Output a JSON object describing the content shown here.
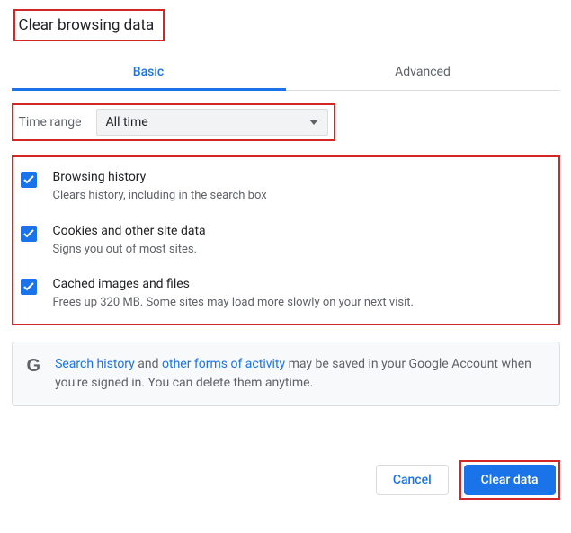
{
  "title": "Clear browsing data",
  "tabs": {
    "basic": "Basic",
    "advanced": "Advanced"
  },
  "timerange": {
    "label": "Time range",
    "selected": "All time"
  },
  "options": [
    {
      "title": "Browsing history",
      "desc": "Clears history, including in the search box",
      "checked": true
    },
    {
      "title": "Cookies and other site data",
      "desc": "Signs you out of most sites.",
      "checked": true
    },
    {
      "title": "Cached images and files",
      "desc": "Frees up 320 MB. Some sites may load more slowly on your next visit.",
      "checked": true
    }
  ],
  "notice": {
    "link1": "Search history",
    "mid": " and ",
    "link2": "other forms of activity",
    "rest": " may be saved in your Google Account when you're signed in. You can delete them anytime."
  },
  "buttons": {
    "cancel": "Cancel",
    "clear": "Clear data"
  }
}
